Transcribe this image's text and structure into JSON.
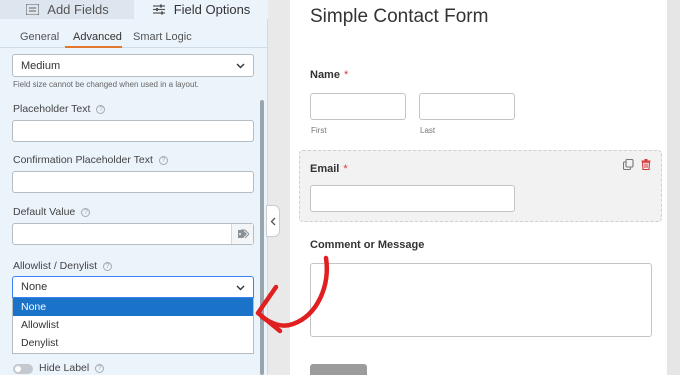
{
  "top_tabs": [
    {
      "label": "Add Fields",
      "icon": "list-icon"
    },
    {
      "label": "Field Options",
      "icon": "sliders-icon"
    }
  ],
  "sub_tabs": [
    {
      "label": "General"
    },
    {
      "label": "Advanced"
    },
    {
      "label": "Smart Logic"
    }
  ],
  "field_size": {
    "value": "Medium",
    "note": "Field size cannot be changed when used in a layout."
  },
  "placeholder_text": {
    "label": "Placeholder Text",
    "value": ""
  },
  "confirmation_placeholder": {
    "label": "Confirmation Placeholder Text",
    "value": ""
  },
  "default_value": {
    "label": "Default Value",
    "value": ""
  },
  "allowlist": {
    "label": "Allowlist / Denylist",
    "value": "None",
    "options": [
      "None",
      "Allowlist",
      "Denylist"
    ]
  },
  "hide_label": {
    "label": "Hide Label",
    "enabled": false
  },
  "preview": {
    "title": "Simple Contact Form",
    "name_label": "Name",
    "required_mark": "*",
    "first_label": "First",
    "last_label": "Last",
    "email_label": "Email",
    "comment_label": "Comment or Message"
  },
  "colors": {
    "accent": "#e27730",
    "selected_option": "#1a73c9",
    "required": "#d63638",
    "annotation_arrow": "#e02020"
  }
}
